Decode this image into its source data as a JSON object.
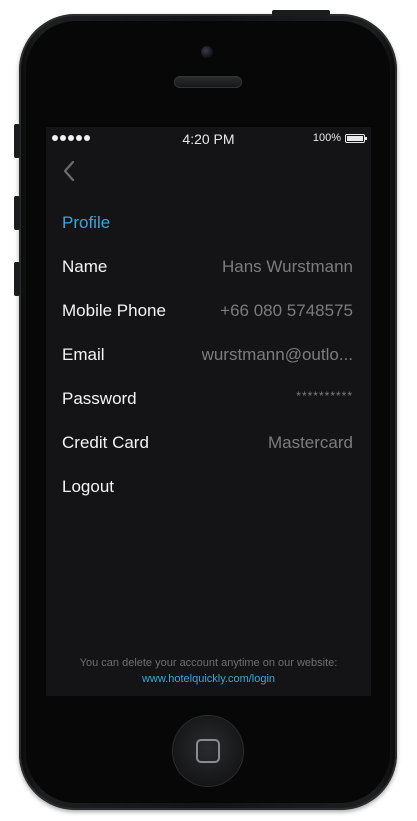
{
  "status_bar": {
    "time": "4:20 PM",
    "battery": "100%"
  },
  "nav": {
    "back_icon": "chevron-left-icon"
  },
  "profile": {
    "title": "Profile",
    "rows": [
      {
        "label": "Name",
        "value": "Hans Wurstmann"
      },
      {
        "label": "Mobile Phone",
        "value": "+66 080 5748575"
      },
      {
        "label": "Email",
        "value": "wurstmann@outlo..."
      },
      {
        "label": "Password",
        "value": "**********"
      },
      {
        "label": "Credit Card",
        "value": "Mastercard"
      },
      {
        "label": "Logout",
        "value": ""
      }
    ]
  },
  "footer": {
    "note": "You can delete your account anytime on our website:",
    "link": "www.hotelquickly.com/login"
  },
  "colors": {
    "accent": "#3ba5d9",
    "screen_bg": "#141416",
    "label": "#f4f4f4",
    "value": "#7c7c80"
  }
}
